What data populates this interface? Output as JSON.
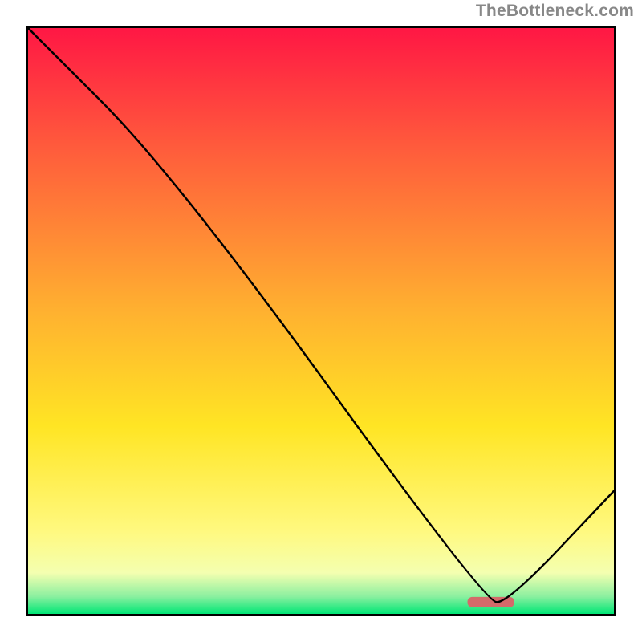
{
  "watermark": {
    "text": "TheBottleneck.com"
  },
  "chart_data": {
    "type": "line",
    "title": "",
    "xlabel": "",
    "ylabel": "",
    "xlim": [
      0,
      100
    ],
    "ylim": [
      0,
      100
    ],
    "series": [
      {
        "name": "bottleneck-curve",
        "x": [
          0,
          25,
          78,
          82,
          100
        ],
        "y": [
          100,
          75,
          2,
          2,
          21
        ]
      }
    ],
    "marker": {
      "name": "optimal-marker",
      "x_range": [
        75,
        83
      ],
      "y": 2,
      "color": "#d46a6a"
    },
    "background_gradient_stops": [
      {
        "pct": 0,
        "color": "#ff1744"
      },
      {
        "pct": 20,
        "color": "#ff5a3c"
      },
      {
        "pct": 48,
        "color": "#ffb030"
      },
      {
        "pct": 68,
        "color": "#ffe524"
      },
      {
        "pct": 86,
        "color": "#fff980"
      },
      {
        "pct": 93,
        "color": "#f4ffb0"
      },
      {
        "pct": 97,
        "color": "#8cf0a0"
      },
      {
        "pct": 100,
        "color": "#00e676"
      }
    ]
  }
}
